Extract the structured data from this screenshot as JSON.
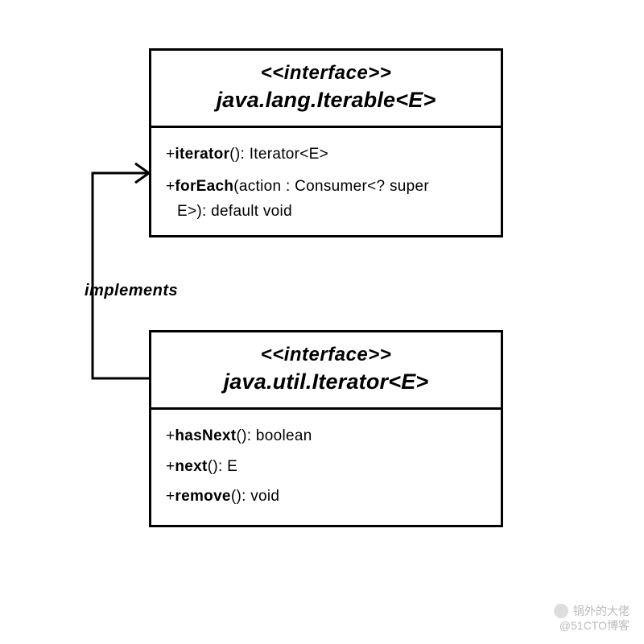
{
  "diagram": {
    "relationship_label": "implements",
    "boxes": {
      "iterable": {
        "stereotype": "<<interface>>",
        "classname": "java.lang.Iterable<E>",
        "methods": {
          "m1_prefix": "+",
          "m1_name": "iterator",
          "m1_suffix": "(): Iterator<E>",
          "m2_prefix": "+",
          "m2_name": "forEach",
          "m2_mid": "(action : Consumer<? super",
          "m2_cont": "E>): default void"
        }
      },
      "iterator": {
        "stereotype": "<<interface>>",
        "classname": "java.util.Iterator<E>",
        "methods": {
          "m1_prefix": "+",
          "m1_name": "hasNext",
          "m1_suffix": "(): boolean",
          "m2_prefix": "+",
          "m2_name": "next",
          "m2_suffix": "(): E",
          "m3_prefix": "+",
          "m3_name": "remove",
          "m3_suffix": "(): void"
        }
      }
    }
  },
  "watermark": {
    "line1": "锅外的大佬",
    "line2": "@51CTO博客"
  }
}
